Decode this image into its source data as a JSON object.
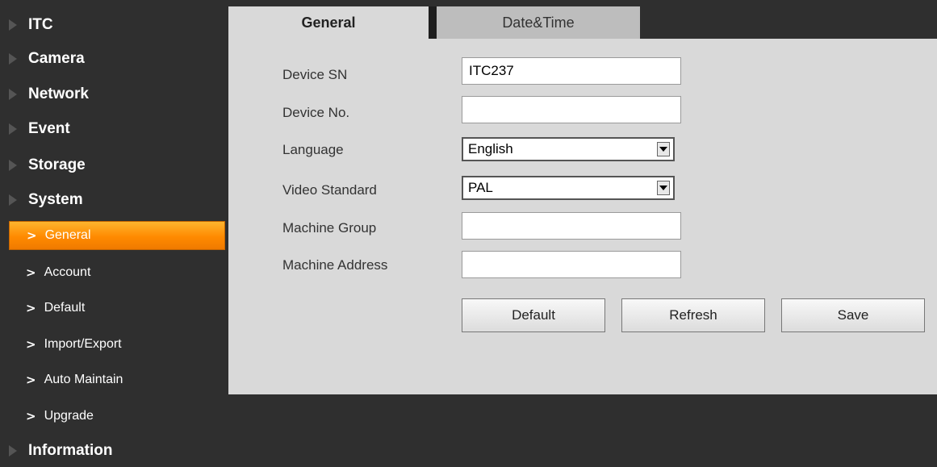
{
  "sidebar": {
    "top_items": [
      {
        "label": "ITC"
      },
      {
        "label": "Camera"
      },
      {
        "label": "Network"
      },
      {
        "label": "Event"
      },
      {
        "label": "Storage"
      },
      {
        "label": "System"
      },
      {
        "label": "Information"
      }
    ],
    "sub_items": [
      {
        "label": "General",
        "active": true
      },
      {
        "label": "Account"
      },
      {
        "label": "Default"
      },
      {
        "label": "Import/Export"
      },
      {
        "label": "Auto Maintain"
      },
      {
        "label": "Upgrade"
      }
    ],
    "sub_chevron": ">"
  },
  "tabs": [
    {
      "label": "General",
      "active": true
    },
    {
      "label": "Date&Time"
    }
  ],
  "form": {
    "device_sn": {
      "label": "Device SN",
      "value": "ITC237"
    },
    "device_no": {
      "label": "Device No.",
      "value": ""
    },
    "language": {
      "label": "Language",
      "value": "English"
    },
    "video_standard": {
      "label": "Video Standard",
      "value": "PAL"
    },
    "machine_group": {
      "label": "Machine Group",
      "value": ""
    },
    "machine_address": {
      "label": "Machine Address",
      "value": ""
    }
  },
  "buttons": {
    "default": "Default",
    "refresh": "Refresh",
    "save": "Save"
  },
  "colors": {
    "active_nav": "#ff9900",
    "background": "#2f2f2f",
    "panel": "#d9d9d9"
  }
}
